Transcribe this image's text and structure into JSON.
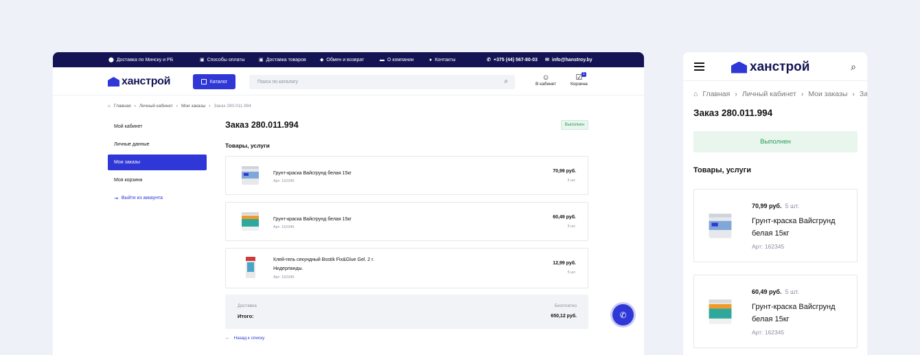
{
  "topbar": {
    "delivery": "Доставка по Минску и РБ",
    "payment": "Способы оплаты",
    "shipping": "Доставка товаров",
    "exchange": "Обмен и возврат",
    "about": "О компании",
    "contacts": "Контакты",
    "phone": "+375 (44) 567-80-03",
    "email": "info@hanstroy.by"
  },
  "header": {
    "logo": "ханстрой",
    "catalog_label": "Каталог",
    "search_placeholder": "Поиск по каталогу",
    "cabinet_label": "В кабинет",
    "cart_label": "Корзина",
    "cart_count": "1"
  },
  "breadcrumbs": [
    "Главная",
    "Личный кабинет",
    "Мои заказы",
    "Заказ 280.011.994"
  ],
  "sidebar": {
    "items": [
      {
        "label": "Мой кабинет"
      },
      {
        "label": "Личные данные"
      },
      {
        "label": "Мои заказы"
      },
      {
        "label": "Моя корзина"
      }
    ],
    "logout": "Выйти из аккаунта"
  },
  "order": {
    "title": "Заказ 280.011.994",
    "status": "Выполнен",
    "section": "Товары, услуги",
    "items": [
      {
        "name": "Грунт-краска Вайсгрунд белая 15кг",
        "article": "Арт: 162345",
        "price": "70,99 руб.",
        "qty": "5 шт."
      },
      {
        "name": "Грунт-краска Вайсгрунд белая 15кг",
        "article": "Арт: 162345",
        "price": "60,49 руб.",
        "qty": "5 шт."
      },
      {
        "name": "Клей-гель секундный Bostik Fix&Glue Gel. 2 г. Нидерланды.",
        "article": "Арт: 162345",
        "price": "12,99 руб.",
        "qty": "5 шт."
      }
    ],
    "delivery_label": "Доставка",
    "delivery_value": "Бесплатно",
    "total_label": "Итого:",
    "total_value": "650,12 руб.",
    "back": "Назад к списку"
  },
  "mobile": {
    "logo": "ханстрой",
    "breadcrumbs": [
      "Главная",
      "Личный кабинет",
      "Мои заказы",
      "За"
    ],
    "title": "Заказ 280.011.994",
    "status": "Выполнен",
    "section": "Товары, услуги",
    "items": [
      {
        "price": "70,99 руб.",
        "qty": "5 шт.",
        "name": "Грунт-краска Вайсгрунд белая 15кг",
        "article": "Арт: 162345"
      },
      {
        "price": "60,49 руб.",
        "qty": "5 шт.",
        "name": "Грунт-краска Вайсгрунд белая 15кг",
        "article": "Арт: 162345"
      }
    ]
  },
  "colors": {
    "accent": "#2f37d6",
    "topbar": "#141454",
    "success": "#2a9b5a"
  },
  "icons": [
    "map-pin-icon",
    "wallet-icon",
    "truck-icon",
    "exchange-icon",
    "company-icon",
    "info-icon",
    "phone-icon",
    "mail-icon",
    "grid-icon",
    "search-icon",
    "user-icon",
    "cart-icon",
    "home-icon",
    "logout-icon",
    "arrow-left-icon",
    "call-icon",
    "menu-icon"
  ]
}
